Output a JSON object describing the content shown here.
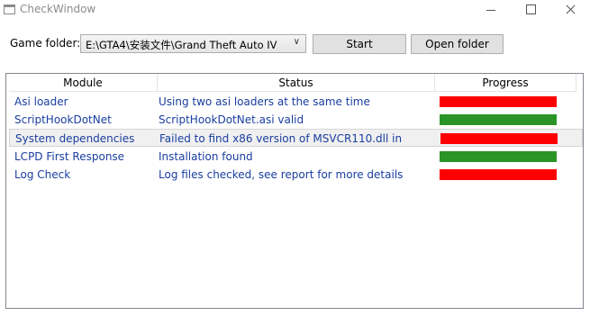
{
  "window": {
    "title": "CheckWindow"
  },
  "toolbar": {
    "folder_label": "Game folder:",
    "folder_value": "E:\\GTA4\\安装文件\\Grand Theft Auto IV",
    "start_label": "Start",
    "open_label": "Open folder"
  },
  "list": {
    "headers": {
      "module": "Module",
      "status": "Status",
      "progress": "Progress"
    },
    "rows": [
      {
        "module": "Asi loader",
        "status": "Using two asi loaders at the same time",
        "progress_color": "#ff0000",
        "progress": 1.0
      },
      {
        "module": "ScriptHookDotNet",
        "status": "ScriptHookDotNet.asi valid",
        "progress_color": "#2a9427",
        "progress": 1.0
      },
      {
        "module": "System dependencies",
        "status": "Failed to find x86 version of MSVCR110.dll in",
        "progress_color": "#ff0000",
        "progress": 1.0
      },
      {
        "module": "LCPD First Response",
        "status": "Installation found",
        "progress_color": "#2a9427",
        "progress": 1.0
      },
      {
        "module": "Log Check",
        "status": "Log files checked, see report for more details",
        "progress_color": "#ff0000",
        "progress": 1.0
      }
    ],
    "selected_index": 2
  }
}
